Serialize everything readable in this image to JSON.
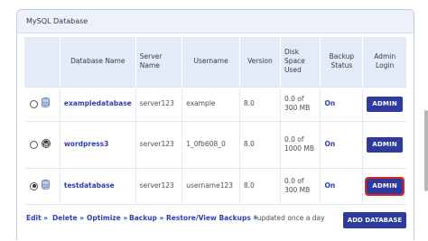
{
  "panel": {
    "title": "MySQL Database"
  },
  "table": {
    "headers": {
      "name": "Database Name",
      "server": "Server Name",
      "username": "Username",
      "version": "Version",
      "disk": "Disk Space Used",
      "backup": "Backup Status",
      "admin": "Admin Login"
    },
    "rows": [
      {
        "name": "exampledatabase",
        "server": "server123",
        "username": "example",
        "version": "8.0",
        "disk": "0.0 of 300 MB",
        "backup": "On",
        "admin": "ADMIN",
        "icon": "mysql-database-icon",
        "selected": false
      },
      {
        "name": "wordpress3",
        "server": "server123",
        "username": "1_0fb608_0",
        "version": "8.0",
        "disk": "0.0 of 1000 MB",
        "backup": "On",
        "admin": "ADMIN",
        "icon": "wordpress-icon",
        "selected": false
      },
      {
        "name": "testdatabase",
        "server": "server123",
        "username": "username123",
        "version": "8.0",
        "disk": "0.0 of 300 MB",
        "backup": "On",
        "admin": "ADMIN",
        "icon": "mysql-database-icon",
        "selected": true
      }
    ]
  },
  "footer": {
    "edit": "Edit »",
    "delete": "Delete »",
    "optimize": "Optimize »",
    "backup": "Backup »",
    "restore": "Restore/View Backups »",
    "note": "*updated once a day",
    "add": "ADD DATABASE"
  },
  "colors": {
    "accent": "#2f3a9e",
    "link": "#2d3fb0",
    "header_bg": "#e4eaf8",
    "focus_outline": "#d62828"
  }
}
